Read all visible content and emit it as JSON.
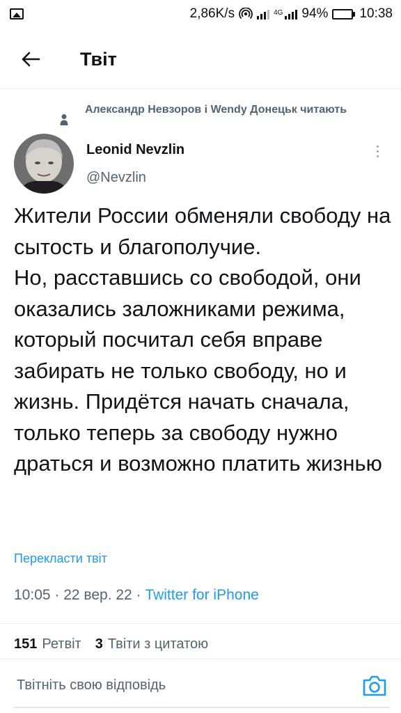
{
  "status_bar": {
    "network_speed": "2,86K/s",
    "network_tag": "4G",
    "battery_text": "94%",
    "battery_level": 0.94,
    "battery_color": "#2ec24a",
    "time": "10:38"
  },
  "header": {
    "title": "Твіт"
  },
  "tweet": {
    "social_context": "Александр Невзоров і Wendy Донецьк читають",
    "author_name": "Leonid Nevzlin",
    "author_handle": "@Nevzlin",
    "text": "Жители России обменяли свободу на сытость и благополучие.\nНо, расставшись со свободой, они оказались заложниками режима, который посчитал себя вправе забирать не только свободу, но и жизнь. Придётся начать сначала, только теперь за свободу нужно драться и возможно платить жизнью",
    "translate_label": "Перекласти твіт",
    "time": "10:05",
    "date": "22 вер. 22",
    "source": "Twitter for iPhone",
    "separator": " · "
  },
  "stats": {
    "retweets_count": "151",
    "retweets_label": "Ретвіт",
    "quotes_count": "3",
    "quotes_label": "Твіти з цитатою"
  },
  "reply": {
    "placeholder": "Твітніть свою відповідь"
  },
  "icons": {
    "back": "arrow-left-icon",
    "more": "more-vertical-icon",
    "person": "person-icon",
    "camera": "camera-icon"
  },
  "colors": {
    "accent": "#1d9bf0",
    "secondary_text": "#536471",
    "primary_text": "#0f1419"
  }
}
